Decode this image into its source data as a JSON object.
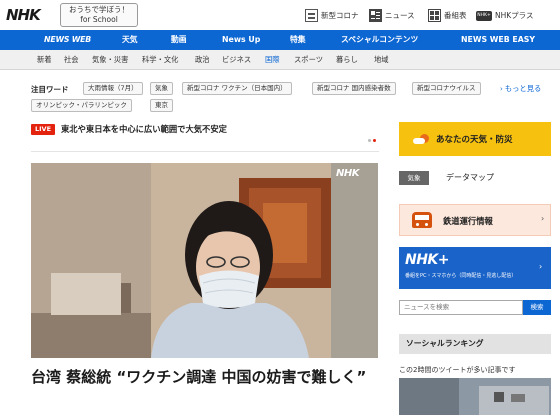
{
  "header": {
    "logo": "NHK",
    "school_line1": "おうちで学ぼう！",
    "school_line2": "for School",
    "links": [
      {
        "label": "新型コロナ",
        "icon": "covid-icon"
      },
      {
        "label": "ニュース",
        "icon": "news-icon"
      },
      {
        "label": "番組表",
        "icon": "tv-guide-icon"
      },
      {
        "label": "NHKプラス",
        "icon": "nhk-plus-icon",
        "badge": "NHK+"
      }
    ]
  },
  "nav": {
    "brand": "NEWS WEB",
    "items": [
      "天気",
      "動画",
      "News Up",
      "特集",
      "スペシャルコンテンツ",
      "NEWS WEB EASY"
    ]
  },
  "subnav": {
    "items": [
      "新着",
      "社会",
      "気象・災害",
      "科学・文化",
      "政治",
      "ビジネス",
      "国際",
      "スポーツ",
      "暮らし",
      "地域"
    ],
    "active": "国際"
  },
  "trending": {
    "title": "注目ワード",
    "tags": [
      "大雨情報（7月）",
      "気象",
      "新型コロナ ワクチン（日本国内）",
      "新型コロナ 国内感染者数",
      "新型コロナウイルス",
      "オリンピック・パラリンピック",
      "東京"
    ],
    "more": "もっと見る"
  },
  "live": {
    "badge": "LIVE",
    "text": "東北や東日本を中心に広い範囲で大気不安定"
  },
  "main": {
    "watermark": "NHK",
    "headline": "台湾 蔡総統 “ワクチン調達 中国の妨害で難しく”"
  },
  "sidebar": {
    "weather_label": "あなたの天気・防災",
    "kisho_badge": "気象",
    "datamap_label": "データマップ",
    "rail_label": "鉄道運行情報",
    "plus_title": "NHK+",
    "plus_sub": "番組をPC・スマホから（同時配信・見逃し配信）",
    "search_placeholder": "ニュースを検索",
    "search_button": "検索",
    "social_title": "ソーシャルランキング",
    "social_sub": "この2時間のツイートが多い記事です"
  },
  "colors": {
    "nav_blue": "#0d67d3",
    "live_red": "#e4230f",
    "weather_yellow": "#f6c10f",
    "plus_blue": "#1a63c8"
  }
}
